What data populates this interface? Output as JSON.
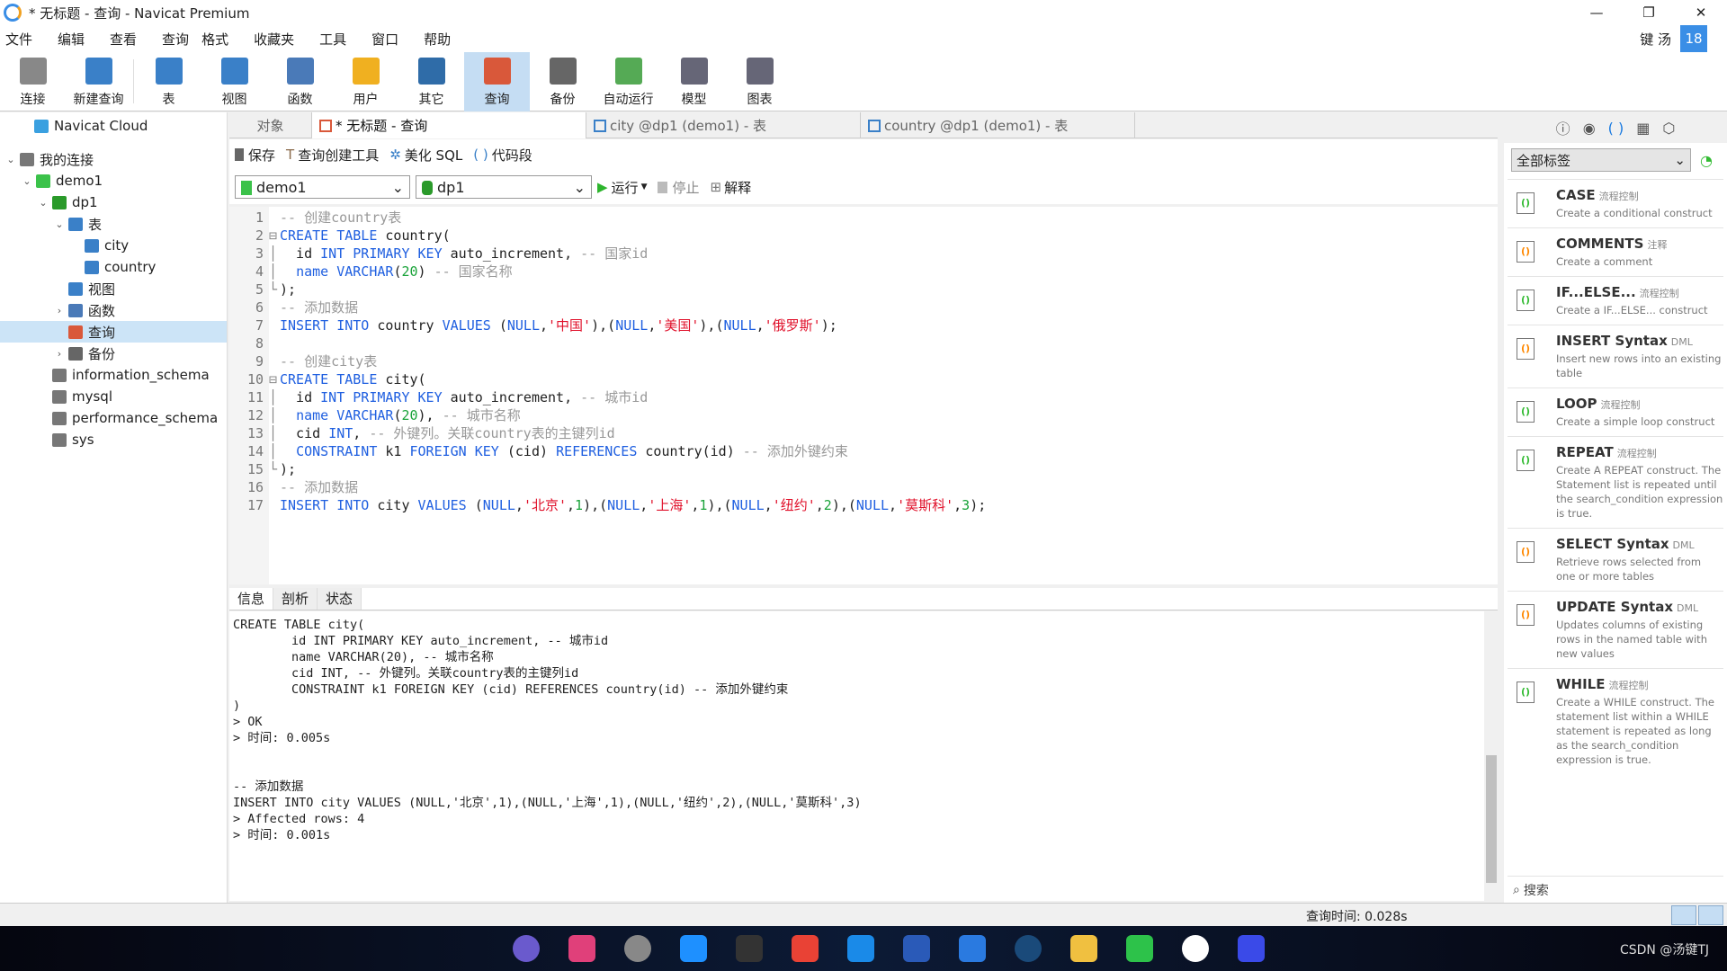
{
  "window": {
    "title": "* 无标题 - 查询 - Navicat Premium",
    "minimize": "—",
    "restore": "❐",
    "close": "✕"
  },
  "menu": {
    "items": [
      "文件",
      "编辑",
      "查看",
      "查询",
      "格式",
      "收藏夹",
      "工具",
      "窗口",
      "帮助"
    ],
    "user": "键 汤",
    "badge": "18"
  },
  "toolbar": {
    "items": [
      {
        "label": "连接",
        "icon": "plug-icon",
        "color": "#888"
      },
      {
        "label": "新建查询",
        "icon": "new-query-icon",
        "color": "#3a80c8"
      },
      {
        "label": "表",
        "icon": "table-icon",
        "color": "#3a80c8"
      },
      {
        "label": "视图",
        "icon": "view-icon",
        "color": "#3a80c8"
      },
      {
        "label": "函数",
        "icon": "function-icon",
        "color": "#4a7ab8"
      },
      {
        "label": "用户",
        "icon": "user-icon",
        "color": "#f0b020"
      },
      {
        "label": "其它",
        "icon": "tools-icon",
        "color": "#2f6ca8"
      },
      {
        "label": "查询",
        "icon": "query-icon",
        "color": "#d9583a"
      },
      {
        "label": "备份",
        "icon": "backup-icon",
        "color": "#666"
      },
      {
        "label": "自动运行",
        "icon": "schedule-icon",
        "color": "#5a5"
      },
      {
        "label": "模型",
        "icon": "model-icon",
        "color": "#667"
      },
      {
        "label": "图表",
        "icon": "chart-icon",
        "color": "#667"
      }
    ]
  },
  "sidebar": {
    "items": [
      {
        "label": "Navicat Cloud",
        "arrow": "",
        "icon": "cloud-icon",
        "color": "#3aa0e0",
        "level": 0
      },
      {
        "label": "我的连接",
        "arrow": "⌄",
        "icon": "plug-icon",
        "color": "#777",
        "level": 0
      },
      {
        "label": "demo1",
        "arrow": "⌄",
        "icon": "mysql-connection-icon",
        "color": "#3bc24a",
        "level": 1
      },
      {
        "label": "dp1",
        "arrow": "⌄",
        "icon": "database-icon",
        "color": "#2a9a2a",
        "level": 2
      },
      {
        "label": "表",
        "arrow": "⌄",
        "icon": "table-icon",
        "color": "#3a80c8",
        "level": 3
      },
      {
        "label": "city",
        "arrow": "",
        "icon": "table-icon",
        "color": "#3a80c8",
        "level": 4
      },
      {
        "label": "country",
        "arrow": "",
        "icon": "table-icon",
        "color": "#3a80c8",
        "level": 4
      },
      {
        "label": "视图",
        "arrow": "",
        "icon": "view-icon",
        "color": "#3a80c8",
        "level": 3
      },
      {
        "label": "函数",
        "arrow": "›",
        "icon": "function-icon",
        "color": "#4a7ab8",
        "level": 3
      },
      {
        "label": "查询",
        "arrow": "",
        "icon": "query-icon",
        "color": "#d9583a",
        "level": 3,
        "selected": true
      },
      {
        "label": "备份",
        "arrow": "›",
        "icon": "backup-icon",
        "color": "#666",
        "level": 3
      },
      {
        "label": "information_schema",
        "arrow": "",
        "icon": "database-icon",
        "color": "#777",
        "level": 2
      },
      {
        "label": "mysql",
        "arrow": "",
        "icon": "database-icon",
        "color": "#777",
        "level": 2
      },
      {
        "label": "performance_schema",
        "arrow": "",
        "icon": "database-icon",
        "color": "#777",
        "level": 2
      },
      {
        "label": "sys",
        "arrow": "",
        "icon": "database-icon",
        "color": "#777",
        "level": 2
      }
    ]
  },
  "tabs": [
    {
      "label": "对象"
    },
    {
      "label": "* 无标题 - 查询",
      "active": true
    },
    {
      "label": "city @dp1 (demo1) - 表"
    },
    {
      "label": "country @dp1 (demo1) - 表"
    }
  ],
  "query_toolbar": {
    "save": "保存",
    "builder": "查询创建工具",
    "beautify": "美化 SQL",
    "snippet": "代码段",
    "connection": "demo1",
    "database": "dp1",
    "run": "运行",
    "stop": "停止",
    "explain": "解释"
  },
  "editor": {
    "lines": [
      [
        [
          "cm",
          "-- 创建country表"
        ]
      ],
      [
        [
          "kw",
          "CREATE TABLE"
        ],
        [
          "pl",
          " country("
        ]
      ],
      [
        [
          "pl",
          "  id "
        ],
        [
          "kw",
          "INT PRIMARY KEY"
        ],
        [
          "pl",
          " auto_increment, "
        ],
        [
          "cm",
          "-- 国家id"
        ]
      ],
      [
        [
          "pl",
          "  "
        ],
        [
          "kw",
          "name VARCHAR"
        ],
        [
          "pl",
          "("
        ],
        [
          "nu",
          "20"
        ],
        [
          "pl",
          ") "
        ],
        [
          "cm",
          "-- 国家名称"
        ]
      ],
      [
        [
          "pl",
          ");"
        ]
      ],
      [
        [
          "cm",
          "-- 添加数据"
        ]
      ],
      [
        [
          "kw",
          "INSERT INTO"
        ],
        [
          "pl",
          " country "
        ],
        [
          "kw",
          "VALUES"
        ],
        [
          "pl",
          " ("
        ],
        [
          "kw",
          "NULL"
        ],
        [
          "pl",
          ","
        ],
        [
          "st",
          "'中国'"
        ],
        [
          "pl",
          "),("
        ],
        [
          "kw",
          "NULL"
        ],
        [
          "pl",
          ","
        ],
        [
          "st",
          "'美国'"
        ],
        [
          "pl",
          "),("
        ],
        [
          "kw",
          "NULL"
        ],
        [
          "pl",
          ","
        ],
        [
          "st",
          "'俄罗斯'"
        ],
        [
          "pl",
          ");"
        ]
      ],
      [],
      [
        [
          "cm",
          "-- 创建city表"
        ]
      ],
      [
        [
          "kw",
          "CREATE TABLE"
        ],
        [
          "pl",
          " city("
        ]
      ],
      [
        [
          "pl",
          "  id "
        ],
        [
          "kw",
          "INT PRIMARY KEY"
        ],
        [
          "pl",
          " auto_increment, "
        ],
        [
          "cm",
          "-- 城市id"
        ]
      ],
      [
        [
          "pl",
          "  "
        ],
        [
          "kw",
          "name VARCHAR"
        ],
        [
          "pl",
          "("
        ],
        [
          "nu",
          "20"
        ],
        [
          "pl",
          "), "
        ],
        [
          "cm",
          "-- 城市名称"
        ]
      ],
      [
        [
          "pl",
          "  cid "
        ],
        [
          "kw",
          "INT"
        ],
        [
          "pl",
          ", "
        ],
        [
          "cm",
          "-- 外键列。关联country表的主键列id"
        ]
      ],
      [
        [
          "pl",
          "  "
        ],
        [
          "kw",
          "CONSTRAINT"
        ],
        [
          "pl",
          " k1 "
        ],
        [
          "kw",
          "FOREIGN KEY"
        ],
        [
          "pl",
          " (cid) "
        ],
        [
          "kw",
          "REFERENCES"
        ],
        [
          "pl",
          " country(id) "
        ],
        [
          "cm",
          "-- 添加外键约束"
        ]
      ],
      [
        [
          "pl",
          ");"
        ]
      ],
      [
        [
          "cm",
          "-- 添加数据"
        ]
      ],
      [
        [
          "kw",
          "INSERT INTO"
        ],
        [
          "pl",
          " city "
        ],
        [
          "kw",
          "VALUES"
        ],
        [
          "pl",
          " ("
        ],
        [
          "kw",
          "NULL"
        ],
        [
          "pl",
          ","
        ],
        [
          "st",
          "'北京'"
        ],
        [
          "pl",
          ","
        ],
        [
          "nu",
          "1"
        ],
        [
          "pl",
          "),("
        ],
        [
          "kw",
          "NULL"
        ],
        [
          "pl",
          ","
        ],
        [
          "st",
          "'上海'"
        ],
        [
          "pl",
          ","
        ],
        [
          "nu",
          "1"
        ],
        [
          "pl",
          "),("
        ],
        [
          "kw",
          "NULL"
        ],
        [
          "pl",
          ","
        ],
        [
          "st",
          "'纽约'"
        ],
        [
          "pl",
          ","
        ],
        [
          "nu",
          "2"
        ],
        [
          "pl",
          "),("
        ],
        [
          "kw",
          "NULL"
        ],
        [
          "pl",
          ","
        ],
        [
          "st",
          "'莫斯科'"
        ],
        [
          "pl",
          ","
        ],
        [
          "nu",
          "3"
        ],
        [
          "pl",
          ");"
        ]
      ]
    ]
  },
  "result_tabs": [
    "信息",
    "剖析",
    "状态"
  ],
  "output": [
    "CREATE TABLE city(",
    "\tid INT PRIMARY KEY auto_increment, -- 城市id",
    "\tname VARCHAR(20), -- 城市名称",
    "\tcid INT, -- 外键列。关联country表的主键列id",
    "\tCONSTRAINT k1 FOREIGN KEY (cid) REFERENCES country(id) -- 添加外键约束",
    ")",
    "> OK",
    "> 时间: 0.005s",
    "",
    "",
    "-- 添加数据",
    "INSERT INTO city VALUES (NULL,'北京',1),(NULL,'上海',1),(NULL,'纽约',2),(NULL,'莫斯科',3)",
    "> Affected rows: 4",
    "> 时间: 0.001s"
  ],
  "snippets": {
    "filter": "全部标签",
    "search_placeholder": "搜索",
    "items": [
      {
        "name": "CASE",
        "tag": "流程控制",
        "desc": "Create a conditional construct",
        "kind": "flow"
      },
      {
        "name": "COMMENTS",
        "tag": "注释",
        "desc": "Create a comment",
        "kind": "dml"
      },
      {
        "name": "IF...ELSE...",
        "tag": "流程控制",
        "desc": "Create a IF...ELSE... construct",
        "kind": "flow"
      },
      {
        "name": "INSERT Syntax",
        "tag": "DML",
        "desc": "Insert new rows into an existing table",
        "kind": "dml"
      },
      {
        "name": "LOOP",
        "tag": "流程控制",
        "desc": "Create a simple loop construct",
        "kind": "flow"
      },
      {
        "name": "REPEAT",
        "tag": "流程控制",
        "desc": "Create A REPEAT construct. The Statement list is repeated until the search_condition expression is true.",
        "kind": "flow"
      },
      {
        "name": "SELECT Syntax",
        "tag": "DML",
        "desc": "Retrieve rows selected from one or more tables",
        "kind": "dml"
      },
      {
        "name": "UPDATE Syntax",
        "tag": "DML",
        "desc": "Updates columns of existing rows in the named table with new values",
        "kind": "dml"
      },
      {
        "name": "WHILE",
        "tag": "流程控制",
        "desc": "Create a WHILE construct. The statement list within a WHILE statement is repeated as long as the search_condition expression is true.",
        "kind": "flow"
      }
    ]
  },
  "status": {
    "query_time": "查询时间: 0.028s"
  },
  "taskbar": {
    "apps": [
      "eclipse",
      "intellij",
      "navicat",
      "app",
      "terminal",
      "chrome",
      "vscode",
      "visio",
      "todo",
      "steam",
      "explorer",
      "wechat",
      "app2",
      "app3"
    ],
    "watermark": "CSDN @汤键TJ"
  }
}
